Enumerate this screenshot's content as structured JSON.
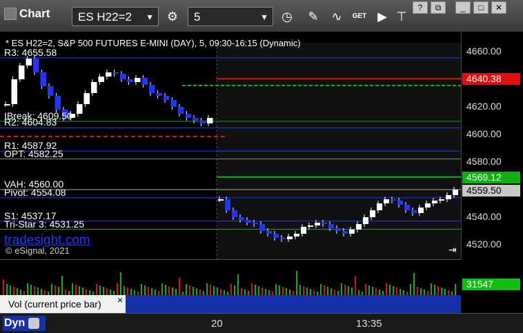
{
  "toolbar": {
    "app_title": "Chart",
    "symbol": "ES H22=2",
    "interval": "5",
    "get_label": "GET"
  },
  "chart": {
    "header": "* ES H22=2, S&P 500 FUTURES E-MINI (DAY), 5, 09:30-16:15 (Dynamic)",
    "watermark": "tradesight.com",
    "copyright": "© eSignal, 2021",
    "levels": [
      {
        "label": "R3: 4655.58",
        "price": 4655.58,
        "color": "#2035ff"
      },
      {
        "label": "IBreak: 4609.50",
        "price": 4609.5,
        "color": "#20a020"
      },
      {
        "label": "R2: 4604.83",
        "price": 4604.83,
        "color": "#2035ff"
      },
      {
        "label": "R1: 4587.92",
        "price": 4587.92,
        "color": "#2035ff"
      },
      {
        "label": "OPT: 4582.25",
        "price": 4582.25,
        "color": "#888888"
      },
      {
        "label": "VAH: 4560.00",
        "price": 4560.0,
        "color": "#aaaaaa"
      },
      {
        "label": "Pivot: 4554.08",
        "price": 4554.08,
        "color": "#2035ff"
      },
      {
        "label": "S1: 4537.17",
        "price": 4537.17,
        "color": "#2035ff"
      },
      {
        "label": "Tri-Star 3: 4531.25",
        "price": 4531.25,
        "color": "#20a020"
      }
    ],
    "price_ticks": [
      "4660.00",
      "4640.00",
      "4620.00",
      "4600.00",
      "4580.00",
      "4560.00",
      "4540.00",
      "4520.00"
    ],
    "price_tags": [
      {
        "label": "4640.38",
        "price": 4640.38,
        "bg": "#e01010",
        "fg": "#ffffff"
      },
      {
        "label": "4569.12",
        "price": 4569.12,
        "bg": "#10b010",
        "fg": "#ffffff"
      },
      {
        "label": "4559.50",
        "price": 4559.5,
        "bg": "#c8c8c8",
        "fg": "#000000"
      }
    ],
    "time_labels": [
      "20",
      "13:35"
    ]
  },
  "volume": {
    "panel_label": "Vol (current price bar)",
    "close_label": "×",
    "value_tag": "31547"
  },
  "footer": {
    "dyn_label": "Dyn"
  },
  "colors": {
    "up_candle": "#ffffff",
    "down_candle": "#2035ff",
    "resistance_red": "#e01010",
    "support_green": "#10b010"
  }
}
